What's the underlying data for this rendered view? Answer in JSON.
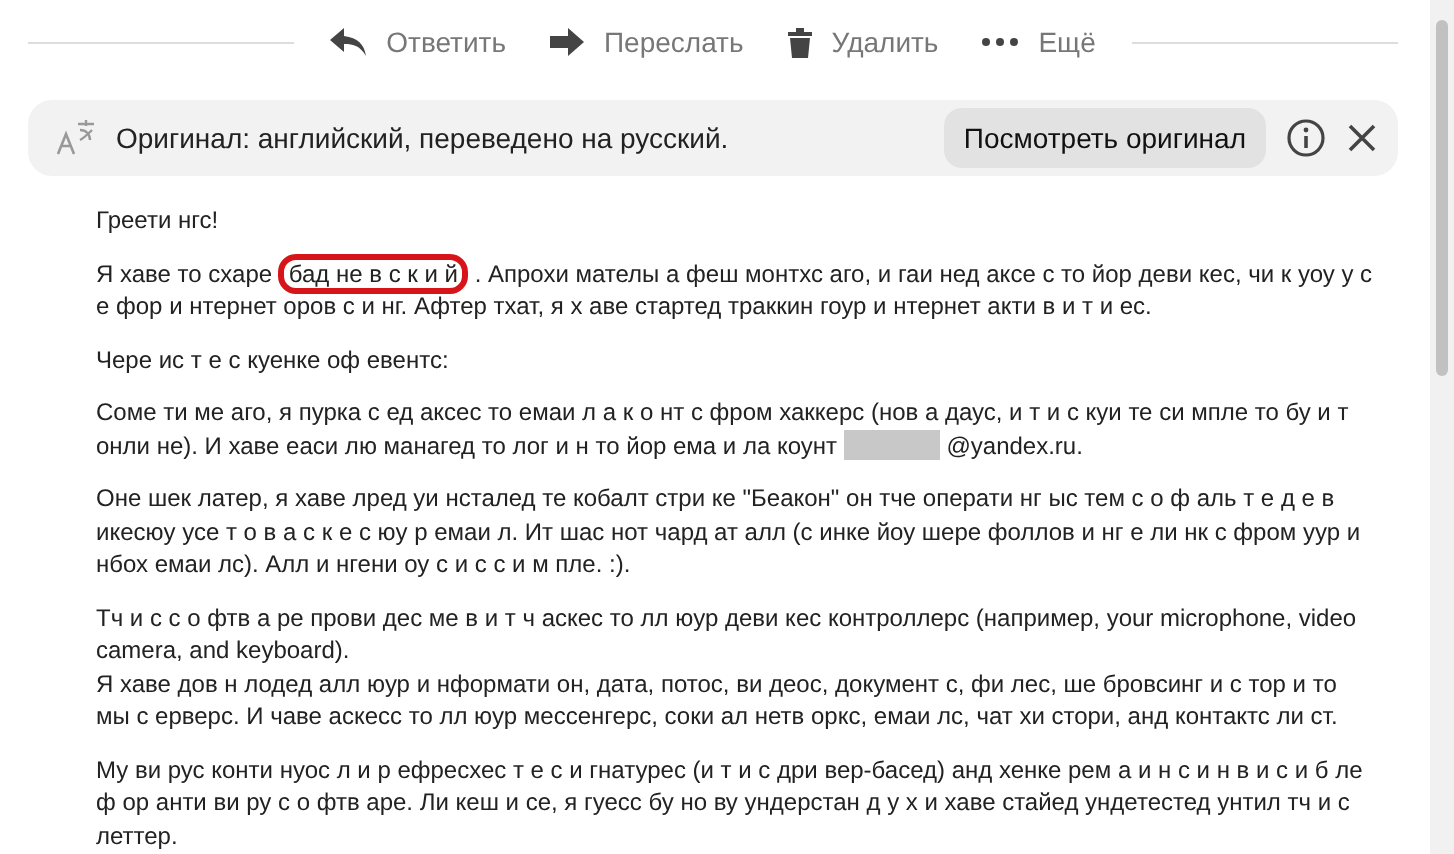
{
  "toolbar": {
    "actions": [
      {
        "kind": "reply",
        "label": "Ответить"
      },
      {
        "kind": "forward",
        "label": "Переслать"
      },
      {
        "kind": "delete",
        "label": "Удалить"
      },
      {
        "kind": "more",
        "label": "Ещё"
      }
    ]
  },
  "translation_bar": {
    "text": "Оригинал: английский, переведено на русский.",
    "button": "Посмотреть оригинал"
  },
  "message": {
    "paragraphs": [
      [
        {
          "kind": "text",
          "text": "Греети нгс!"
        }
      ],
      [
        {
          "kind": "text",
          "text": "Я хаве то схаре"
        },
        {
          "kind": "highlight",
          "text": "бад не в с к и й"
        },
        {
          "kind": "text",
          "text": ". Апрохи мателы а феш монтхс аго, и гаи нед аксе с то йор деви кес, чи к уоу у с е фор и нтернет оров с и нг. Афтер тхат, я х аве стартед траккин гоур и нтернет акти в и т и ес."
        }
      ],
      [
        {
          "kind": "text",
          "text": "Чере ис т е с куенке оф евентс:"
        }
      ],
      [
        {
          "kind": "text",
          "text": "Соме ти ме аго, я пурка с ед аксес то емаи л а к о нт с фром хаккерс (нов а даус, и т и с куи те си мпле то бу и т онли не). И хаве еаси лю манагед то лог и н то йор ема и ла коунт"
        },
        {
          "kind": "redacted"
        },
        {
          "kind": "text",
          "text": "@yandex.ru."
        }
      ],
      [
        {
          "kind": "text",
          "text": "Оне шек латер, я хаве лред уи нсталед те кобалт стри ке \"Беакон\" он тче операти нг ыс тем с о ф аль т е д е в икесюу усе т о в а с к е с юу р емаи л. Ит шас нот чард ат алл (с инке йоу шере фоллов и нг е ли нк с фром уур и нбох емаи лс). Алл и нгени оу с и с с и м пле. :)."
        }
      ],
      [
        {
          "kind": "text",
          "text": "Тч и с с о фтв а ре прови дес ме в и т ч аскес то лл юур деви кес контроллерс (например, your microphone, video camera, and keyboard)."
        },
        {
          "kind": "break"
        },
        {
          "kind": "text",
          "text": "Я хаве дов н лодед алл юур и нформати он, дата, потос, ви деос, документ с, фи лес, ше бровсинг и с тор и то мы с ерверс. И чаве аскесс то лл юур мессенгерс, соки ал нетв оркс, емаи лс, чат хи стори, анд контактс ли ст."
        }
      ],
      [
        {
          "kind": "text",
          "text": "Му ви рус конти нуос л и р ефресхес т е с и гнатурес (и т и с дри вер-басед) анд хенке рем а и н с и н в и с и б ле ф ор анти ви ру с о фтв аре. Ли кеш и се, я гуесс бу но ву ундерстан д у х и хаве стайед ундетестед унтил тч и с леттер."
        }
      ]
    ]
  }
}
